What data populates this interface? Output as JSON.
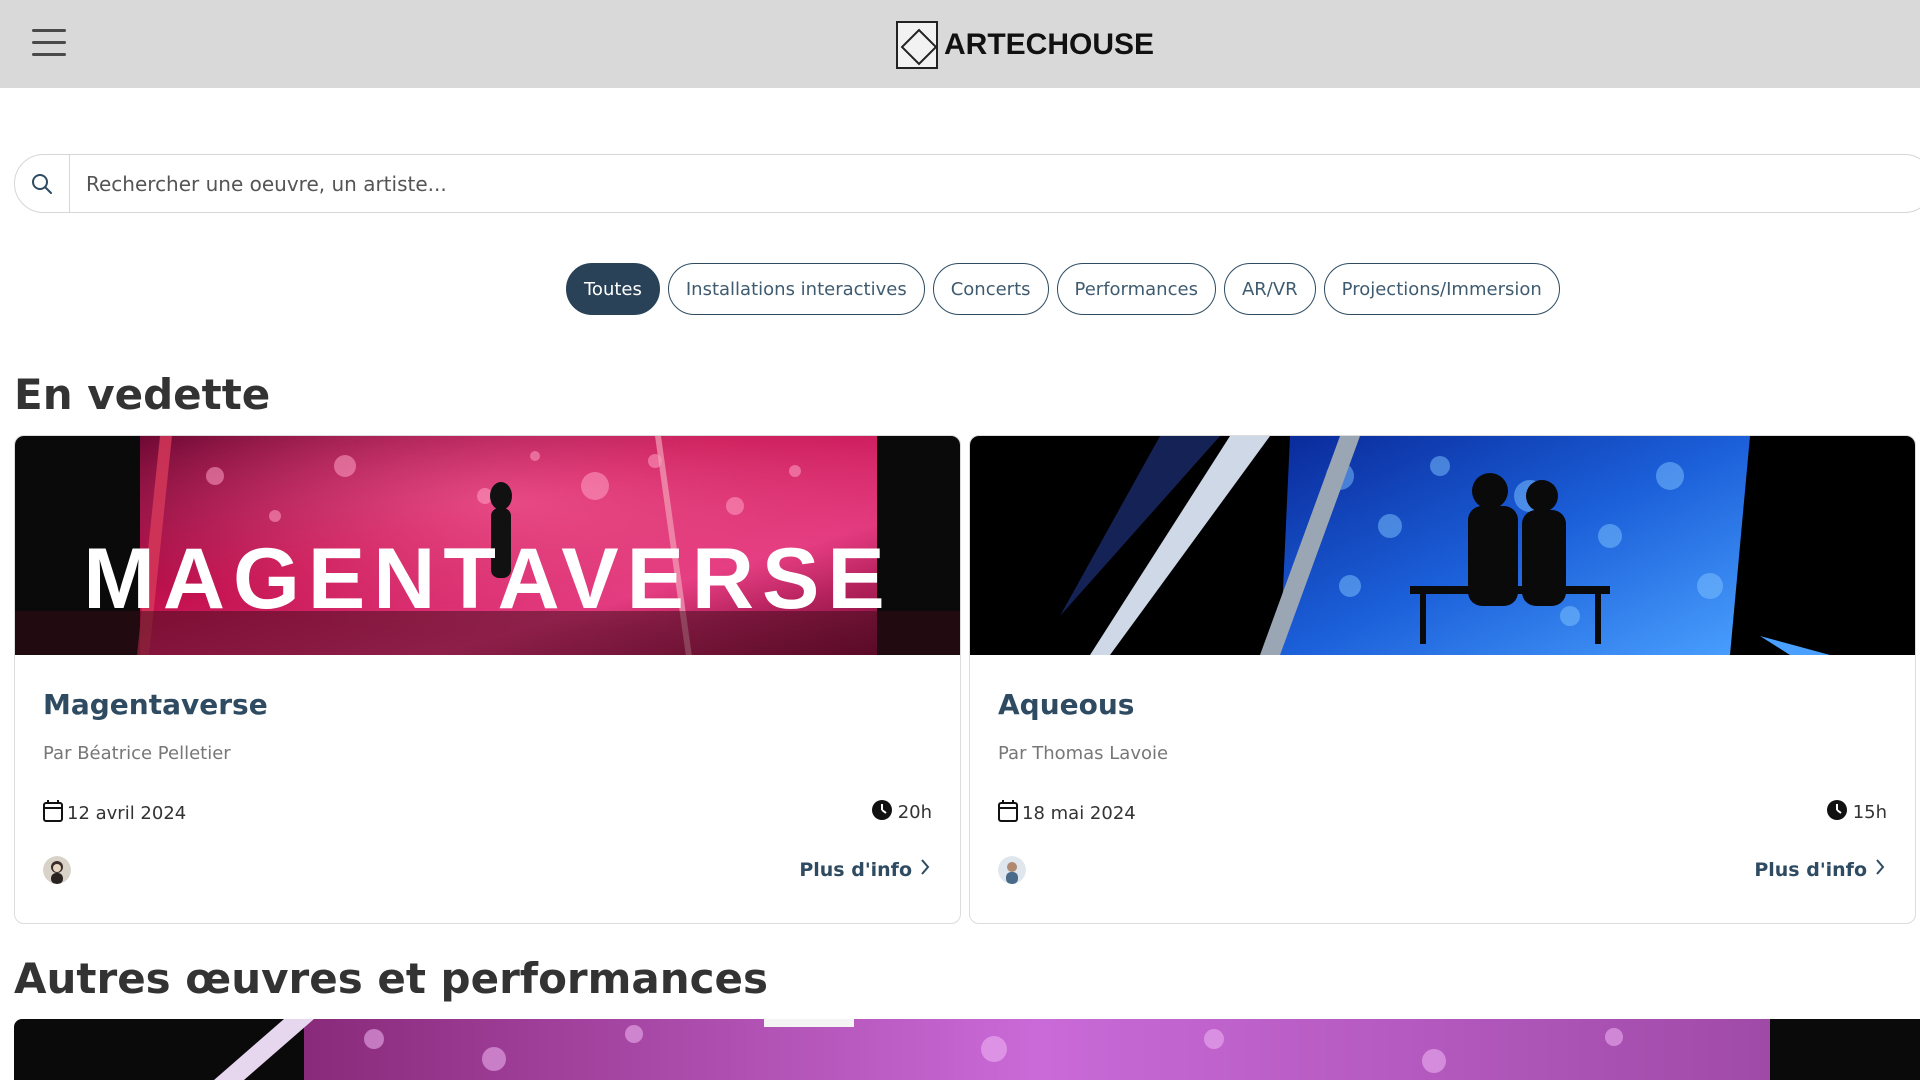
{
  "header": {
    "brand": "ARTECHOUSE",
    "menu_icon": "hamburger-menu-icon"
  },
  "search": {
    "placeholder": "Rechercher une oeuvre, un artiste...",
    "icon": "search-icon"
  },
  "filters": [
    {
      "label": "Toutes",
      "active": true
    },
    {
      "label": "Installations interactives",
      "active": false
    },
    {
      "label": "Concerts",
      "active": false
    },
    {
      "label": "Performances",
      "active": false
    },
    {
      "label": "AR/VR",
      "active": false
    },
    {
      "label": "Projections/Immersion",
      "active": false
    }
  ],
  "featured": {
    "heading": "En vedette",
    "cards": [
      {
        "banner_text": "MAGENTAVERSE",
        "title": "Magentaverse",
        "author": "Par Béatrice Pelletier",
        "date": "12 avril 2024",
        "time": "20h",
        "more": "Plus d'info",
        "accent": "#c4124f"
      },
      {
        "title": "Aqueous",
        "author": "Par Thomas Lavoie",
        "date": "18 mai 2024",
        "time": "15h",
        "more": "Plus d'info",
        "accent": "#1b5fd9"
      }
    ]
  },
  "others": {
    "heading": "Autres œuvres et performances"
  },
  "colors": {
    "primary": "#294257",
    "header_bg": "#d9d9d9",
    "text": "#333333"
  }
}
